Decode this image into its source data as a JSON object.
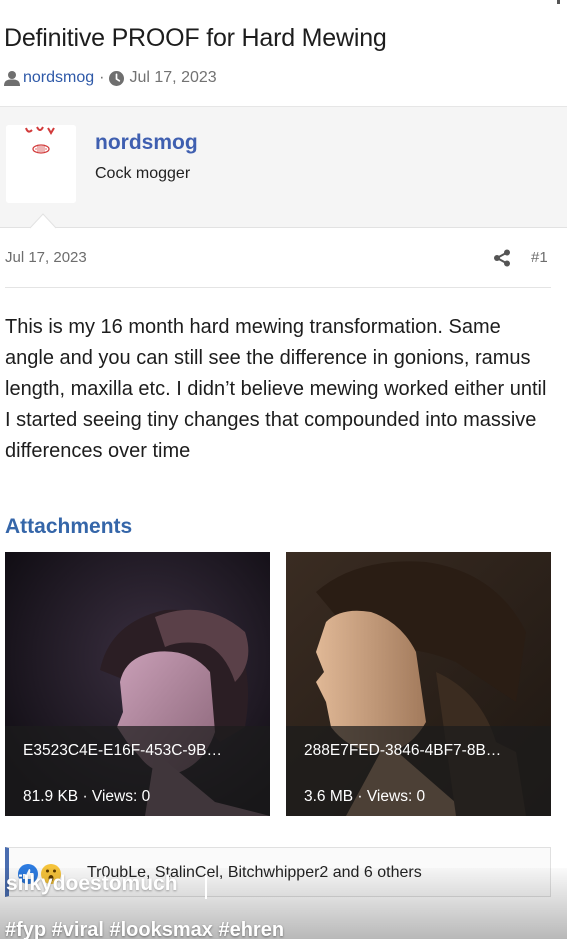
{
  "thread": {
    "title": "Definitive PROOF for Hard Mewing",
    "author": "nordsmog",
    "separator": "·",
    "date": "Jul 17, 2023"
  },
  "author_panel": {
    "name": "nordsmog",
    "user_title": "Cock mogger"
  },
  "post": {
    "date": "Jul 17, 2023",
    "number": "#1",
    "body": "This is my 16 month hard mewing transformation. Same angle and you can still see the difference in gonions, ramus length, maxilla etc. I didn’t believe mewing worked either until I started seeing tiny changes that compounded into massive differences over time"
  },
  "attachments": {
    "heading": "Attachments",
    "items": [
      {
        "filename": "E3523C4E-E16F-453C-9B…",
        "meta": "81.9 KB · Views: 0"
      },
      {
        "filename": "288E7FED-3846-4BF7-8B…",
        "meta": "3.6 MB · Views: 0"
      }
    ]
  },
  "reactions": {
    "text": "Tr0ubLe, StalinCel, Bitchwhipper2 and 6 others",
    "icons": [
      "like-reaction-icon",
      "wow-reaction-icon"
    ]
  },
  "video_overlay": {
    "username": "silkydoestomuch",
    "hashtags": "#fyp #viral #looksmax #ehren"
  },
  "colors": {
    "link_blue": "#2e59a8",
    "author_blue": "#3f5fb0",
    "heading_blue": "#3566a9",
    "panel_bg": "#f5f5f5",
    "reaction_border": "#4a6db0"
  }
}
